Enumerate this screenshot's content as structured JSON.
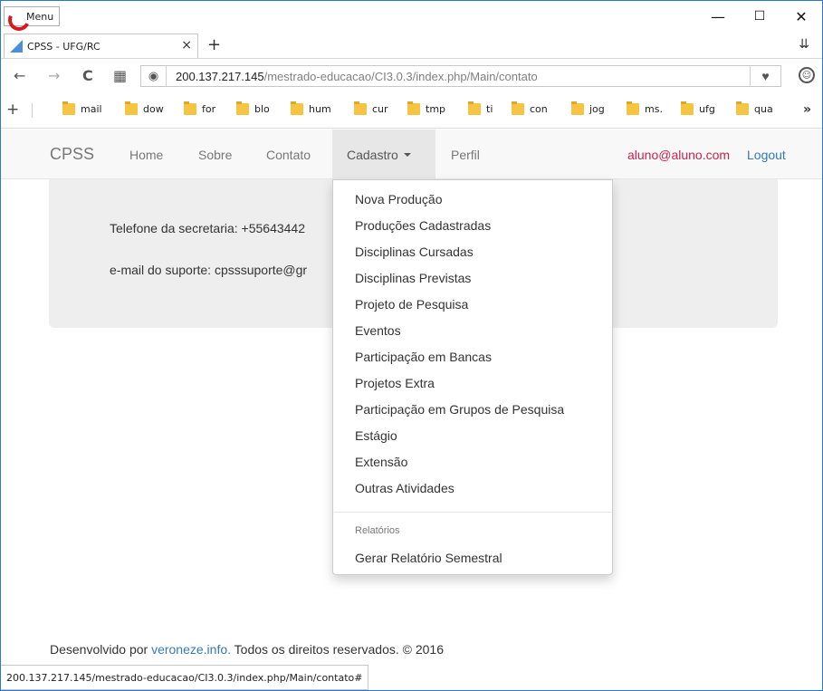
{
  "browser": {
    "menu_label": "Menu",
    "window_controls": {
      "minimize": "—",
      "maximize": "☐",
      "close": "✕"
    },
    "tab": {
      "title": "CPSS - UFG/RC",
      "close": "×"
    },
    "new_tab": "+",
    "tab_menu": "⇊",
    "nav": {
      "back": "←",
      "forward": "→",
      "reload": "C",
      "speed_dial": "▦"
    },
    "url": {
      "host": "200.137.217.145",
      "path": "/mestrado-educacao/CI3.0.3/index.php/Main/contato"
    },
    "heart": "♥",
    "profile": "☺",
    "bookmarks_add": "+",
    "bookmarks": [
      "mail",
      "dow",
      "for",
      "blo",
      "hum",
      "cur",
      "tmp",
      "ti",
      "con",
      "jog",
      "ms.",
      "ufg",
      "qua"
    ],
    "bookmarks_more": "»",
    "status_url": "200.137.217.145/mestrado-educacao/CI3.0.3/index.php/Main/contato#"
  },
  "navbar": {
    "brand": "CPSS",
    "links": [
      "Home",
      "Sobre",
      "Contato"
    ],
    "cadastro": "Cadastro",
    "perfil": "Perfil",
    "user_email": "aluno@aluno.com",
    "logout": "Logout"
  },
  "content": {
    "phone_line": "Telefone da secretaria: +55643442",
    "email_line": "e-mail do suporte: cpsssuporte@gr"
  },
  "dropdown": {
    "items": [
      "Nova Produção",
      "Produções Cadastradas",
      "Disciplinas Cursadas",
      "Disciplinas Previstas",
      "Projeto de Pesquisa",
      "Eventos",
      "Participação em Bancas",
      "Projetos Extra",
      "Participação em Grupos de Pesquisa",
      "Estágio",
      "Extensão",
      "Outras Atividades"
    ],
    "header": "Relatórios",
    "report_item": "Gerar Relatório Semestral"
  },
  "footer": {
    "prefix": "Desenvolvido por ",
    "link": "veroneze.info.",
    "suffix": " Todos os direitos reservados. © 2016"
  },
  "colors": {
    "link": "#337ab7",
    "user": "#c7254e",
    "navbar_bg": "#f8f8f8",
    "active_bg": "#e7e7e7",
    "jumbotron_bg": "#eeeeee",
    "window_border": "#2b79c9"
  }
}
